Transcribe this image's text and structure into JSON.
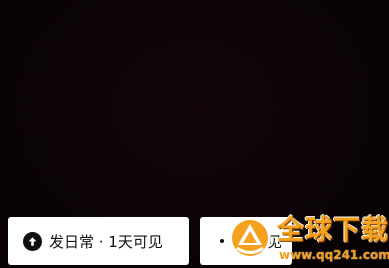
{
  "post_button": {
    "icon": "arrow-up-circle-icon",
    "label": "发日常 · 1天可见"
  },
  "visibility_button": {
    "label": "天可见"
  },
  "watermark": {
    "title": "全球下载",
    "url": "www.qq241.com"
  },
  "colors": {
    "background": "#0b0306",
    "button_bg": "#ffffff",
    "text": "#111111",
    "watermark_orange": "#f5a11d"
  }
}
